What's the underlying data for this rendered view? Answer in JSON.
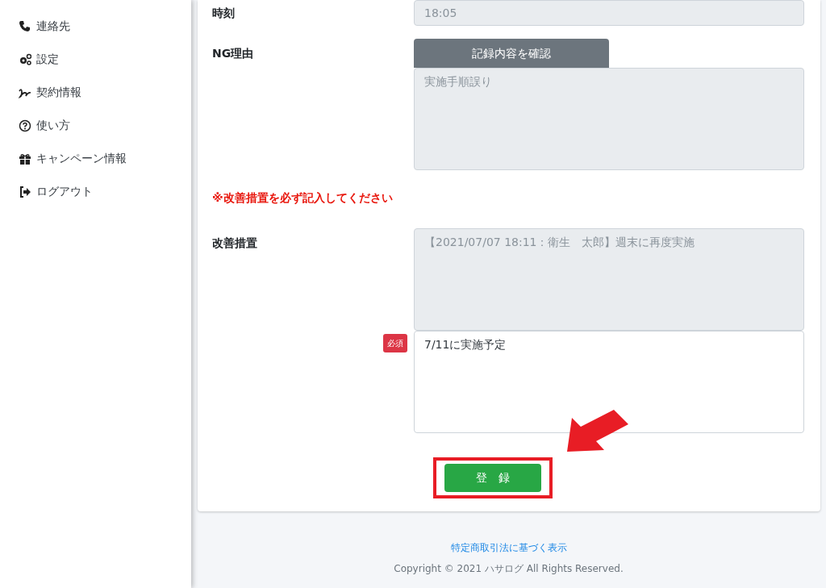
{
  "sidebar": {
    "items": [
      {
        "kind": "phone",
        "label": "連絡先"
      },
      {
        "kind": "gears",
        "label": "設定"
      },
      {
        "kind": "signature",
        "label": "契約情報"
      },
      {
        "kind": "question",
        "label": "使い方"
      },
      {
        "kind": "gift",
        "label": "キャンペーン情報"
      },
      {
        "kind": "logout",
        "label": "ログアウト"
      }
    ]
  },
  "form": {
    "time": {
      "label": "時刻",
      "value": "18:05",
      "disabled": true
    },
    "ng_reason": {
      "label": "NG理由",
      "button": "記録内容を確認",
      "value": "実施手順誤り",
      "disabled": true
    },
    "warning": "※改善措置を必ず記入してください",
    "improvement": {
      "label": "改善措置",
      "history": {
        "value": "【2021/07/07 18:11：衛生　太郎】週末に再度実施",
        "disabled": true
      },
      "required_badge": "必須",
      "input": {
        "value": "7/11に実施予定",
        "disabled": false
      }
    },
    "submit": "登　録"
  },
  "footer": {
    "link": "特定商取引法に基づく表示",
    "copyright": "Copyright © 2021 ハサログ All Rights Reserved."
  }
}
